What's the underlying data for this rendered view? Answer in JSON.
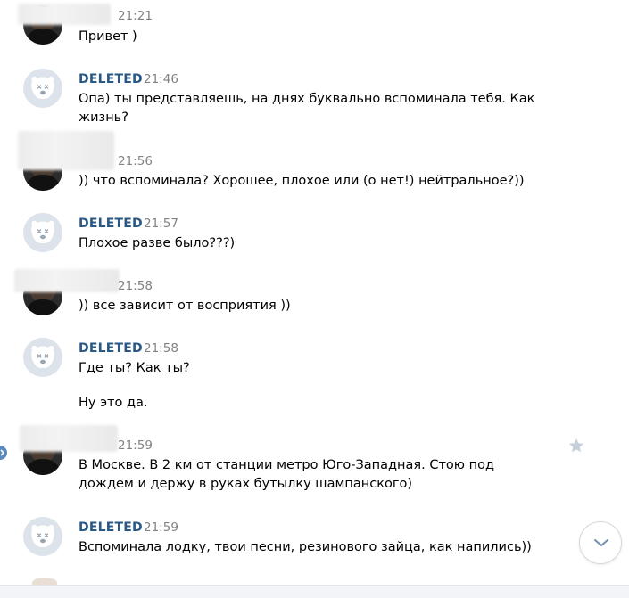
{
  "messages": [
    {
      "kind": "user",
      "author": "",
      "time": "21:21",
      "text": "Привет )"
    },
    {
      "kind": "deleted",
      "author": "DELETED",
      "time": "21:46",
      "text": "Опа) ты представляешь, на днях буквально вспоминала тебя. Как жизнь?"
    },
    {
      "kind": "user",
      "author": "",
      "time": "21:56",
      "text": ")) что вспоминала? Хорошее, плохое или (о нет!) нейтральное?))"
    },
    {
      "kind": "deleted",
      "author": "DELETED",
      "time": "21:57",
      "text": "Плохое разве было???)"
    },
    {
      "kind": "user",
      "author": "",
      "time": "21:58",
      "text": ")) все зависит от восприятия ))"
    },
    {
      "kind": "deleted",
      "author": "DELETED",
      "time": "21:58",
      "text": "Где ты? Как ты?",
      "text2": "Ну это да."
    },
    {
      "kind": "user",
      "author": "",
      "time": "21:59",
      "text": "В Москве. В 2 км от станции метро Юго-Западная. Стою под дождем и держу в руках бутылку шампанского)"
    },
    {
      "kind": "deleted",
      "author": "DELETED",
      "time": "21:59",
      "text": "Вспоминала лодку, твои песни, резинового зайца, как напились))"
    }
  ],
  "icons": {
    "favorite": "star-icon",
    "scroll_down": "chevron-down-icon",
    "deleted_avatar": "dog-icon"
  },
  "colors": {
    "author": "#2a5885",
    "time": "#828282",
    "deleted_avatar_bg": "#dde3ea"
  }
}
